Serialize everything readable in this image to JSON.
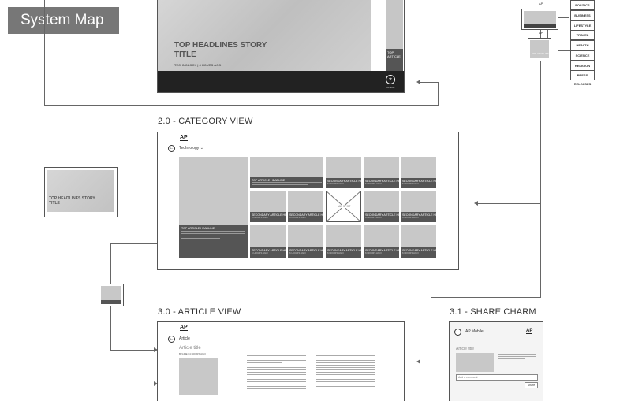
{
  "map_title": "System Map",
  "home": {
    "story_title_line1": "TOP HEADLINES STORY",
    "story_title_line2": "TITLE",
    "story_meta": "TECHNOLOGY  |  4 HOURS AGO",
    "side_label": "TOP ARTICLE",
    "location_label": "Location"
  },
  "categories": [
    "POLITICS",
    "BUSINESS",
    "LIFESTYLE",
    "TRAVEL",
    "HEALTH",
    "SCIENCE",
    "RELIGION",
    "PRESS RELEASES"
  ],
  "top_thumbs": {
    "label_a": "AP",
    "label_b": "AP",
    "caption": "TOP HEADLINE STORY"
  },
  "category_view": {
    "heading": "2.0 - CATEGORY VIEW",
    "logo": "AP",
    "category": "Technology",
    "main_tile_title": "TOP ARTICLE HEADLINE",
    "tile_top_title": "TOP ARTICLE HEADLINE",
    "secondary_title": "SECONDARY ARTICLE HEADLINE",
    "secondary_meta": "6 HOURS AGO",
    "ad_label": "AD SPOT"
  },
  "thumb_left": {
    "title_line1": "TOP HEADLINES STORY",
    "title_line2": "TITLE"
  },
  "article_view": {
    "heading": "3.0 - ARTICLE VIEW",
    "logo": "AP",
    "nav_label": "Article",
    "article_title": "Article title",
    "byline": "BYLINE   |   4 HOURS AGO"
  },
  "share_charm": {
    "heading": "3.1 - SHARE CHARM",
    "logo": "AP",
    "app_name": "AP Mobile",
    "article_title": "Article title",
    "comment_placeholder": "Add a comment",
    "share_button": "Share"
  }
}
